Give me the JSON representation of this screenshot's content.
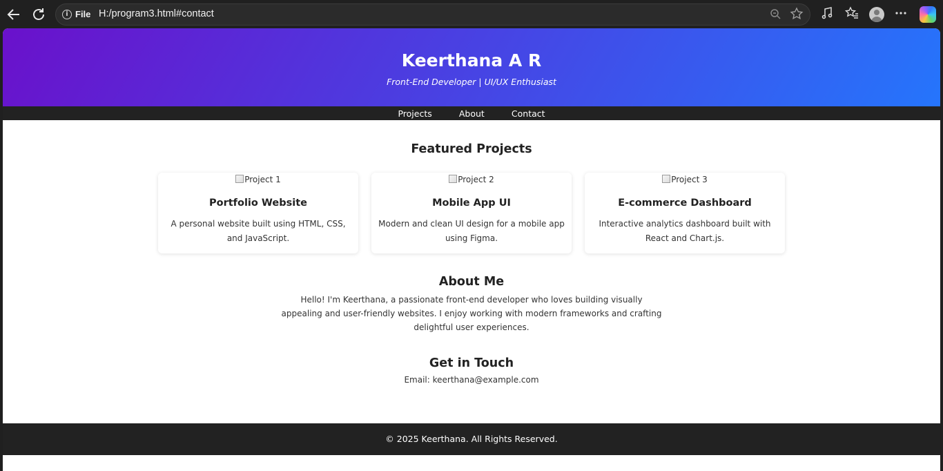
{
  "browser": {
    "file_label": "File",
    "url": "H:/program3.html#contact"
  },
  "header": {
    "name": "Keerthana A R",
    "tagline": "Front-End Developer | UI/UX Enthusiast"
  },
  "nav": {
    "items": [
      "Projects",
      "About",
      "Contact"
    ]
  },
  "projects": {
    "title": "Featured Projects",
    "cards": [
      {
        "image_alt": "Project 1",
        "title": "Portfolio Website",
        "description": "A personal website built using HTML, CSS, and JavaScript."
      },
      {
        "image_alt": "Project 2",
        "title": "Mobile App UI",
        "description": "Modern and clean UI design for a mobile app using Figma."
      },
      {
        "image_alt": "Project 3",
        "title": "E-commerce Dashboard",
        "description": "Interactive analytics dashboard built with React and Chart.js."
      }
    ]
  },
  "about": {
    "title": "About Me",
    "text": "Hello! I'm Keerthana, a passionate front-end developer who loves building visually appealing and user-friendly websites. I enjoy working with modern frameworks and crafting delightful user experiences."
  },
  "contact": {
    "title": "Get in Touch",
    "email_text": "Email: keerthana@example.com"
  },
  "footer": {
    "text": "© 2025 Keerthana. All Rights Reserved."
  },
  "colors": {
    "gradient_start": "#6a11cb",
    "gradient_end": "#2575fc",
    "nav_bg": "#222222"
  }
}
